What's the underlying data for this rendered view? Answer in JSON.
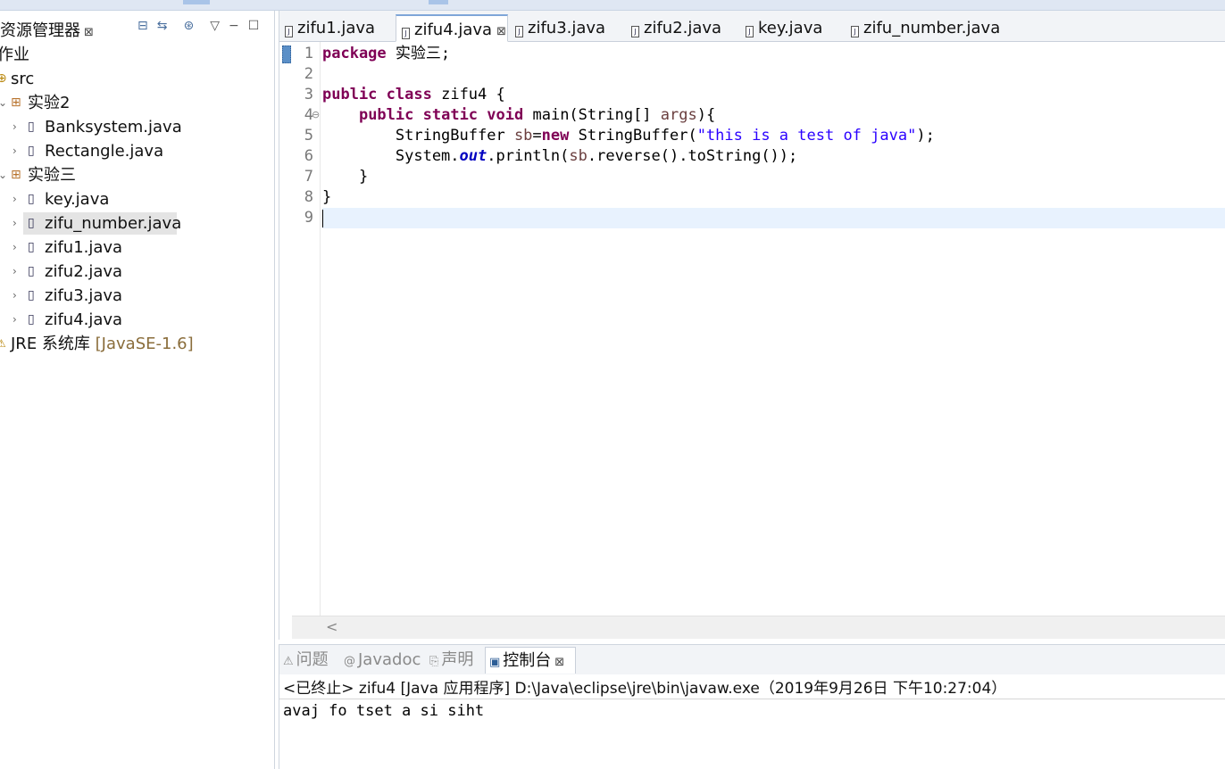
{
  "explorer": {
    "title": "资源管理器",
    "close": "⊠",
    "tools": [
      "⊟",
      "⇆",
      "⊛",
      "▽",
      "−",
      "☐"
    ],
    "project": "作业",
    "src": "src",
    "pkg1": "实验2",
    "pkg1_items": [
      "Banksystem.java",
      "Rectangle.java"
    ],
    "pkg2": "实验三",
    "pkg2_items": [
      "key.java",
      "zifu_number.java",
      "zifu1.java",
      "zifu2.java",
      "zifu3.java",
      "zifu4.java"
    ],
    "jre": "JRE 系统库",
    "jre_version": "[JavaSE-1.6]"
  },
  "editor": {
    "tabs": [
      "zifu1.java",
      "zifu4.java",
      "zifu3.java",
      "zifu2.java",
      "key.java",
      "zifu_number.java"
    ],
    "active_tab": "zifu4.java",
    "tab_close": "⊠",
    "line_numbers": [
      "1",
      "2",
      "3",
      "4",
      "5",
      "6",
      "7",
      "8",
      "9"
    ],
    "fold_marker": "⊖",
    "code": {
      "l1_kw": "package",
      "l1_rest": " 实验三;",
      "l3_kw1": "public",
      "l3_kw2": "class",
      "l3_rest": " zifu4 {",
      "l4_indent": "    ",
      "l4_kw1": "public",
      "l4_kw2": "static",
      "l4_kw3": "void",
      "l4_mid": " main(String[] ",
      "l4_var": "args",
      "l4_end": "){",
      "l5_pre": "        StringBuffer ",
      "l5_var": "sb",
      "l5_eq": "=",
      "l5_kw": "new",
      "l5_mid": " StringBuffer(",
      "l5_str": "\"this is a test of java\"",
      "l5_end": ");",
      "l6_pre": "        System.",
      "l6_fld": "out",
      "l6_mid": ".println(",
      "l6_var": "sb",
      "l6_end": ".reverse().toString());",
      "l7": "    }",
      "l8": "}"
    },
    "scroll_arrow": "<"
  },
  "console": {
    "tabs": [
      {
        "icon": "⚠",
        "label": "问题"
      },
      {
        "icon": "@",
        "label": "Javadoc"
      },
      {
        "icon": "⎘",
        "label": "声明"
      },
      {
        "icon": "▣",
        "label": "控制台"
      }
    ],
    "active_tab": "控制台",
    "close": "⊠",
    "status": "<已终止> zifu4 [Java 应用程序] D:\\Java\\eclipse\\jre\\bin\\javaw.exe（2019年9月26日 下午10:27:04）",
    "output": "avaj fo tset a si siht"
  },
  "colors": {
    "keyword": "#7f0055",
    "string": "#2a00ff",
    "field": "#0000c0",
    "current_line": "#e8f2fe"
  }
}
